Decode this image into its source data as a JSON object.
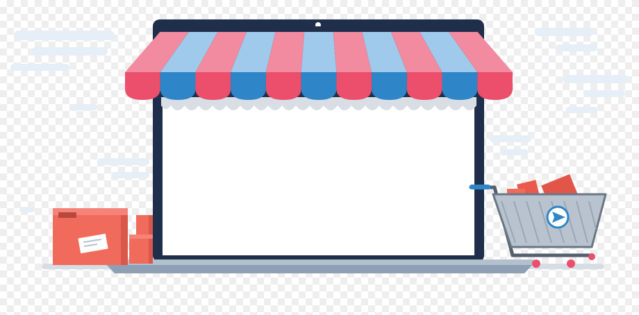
{
  "scene": {
    "subject": "online-shop-illustration",
    "colors": {
      "awning_pink": "#ec4f6b",
      "awning_pink_light": "#f28aa0",
      "awning_blue": "#2e86c8",
      "awning_blue_light": "#9fcaeb",
      "laptop_frame": "#1f2e4b",
      "screen": "#ffffff",
      "laptop_base": "#8fa0b5",
      "cart_body": "#b8c3cf",
      "box_coral": "#f16b5d",
      "box_coral_dark": "#d9574b",
      "cloud": "#e6eef7",
      "shadow": "#d7dde4"
    },
    "icons": [
      "shop-awning-icon",
      "laptop-icon",
      "shopping-cart-icon",
      "package-box-icon",
      "paper-plane-icon"
    ]
  }
}
